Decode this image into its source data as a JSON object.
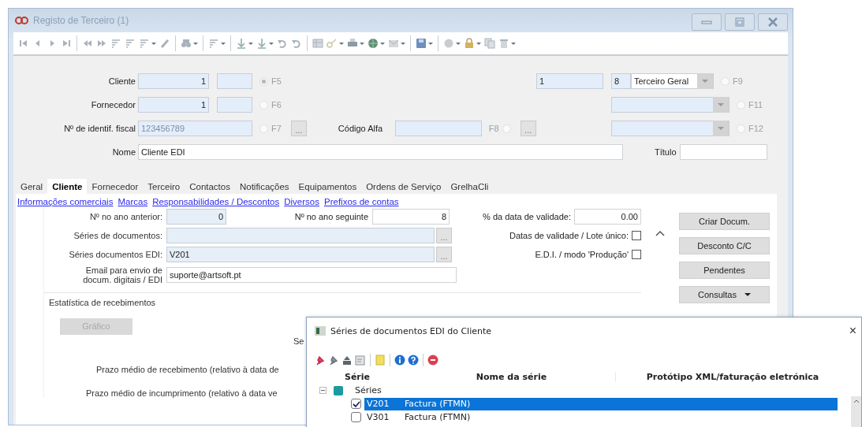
{
  "window": {
    "title": "Registo de Terceiro (1)"
  },
  "header": {
    "rows": [
      {
        "kind": "split",
        "label": "Cliente",
        "value": "1",
        "radio": {
          "label": "F5",
          "selected": true
        }
      },
      {
        "kind": "split",
        "label": "Fornecedor",
        "value": "1",
        "radio": {
          "label": "F6",
          "selected": false
        }
      },
      {
        "kind": "wide",
        "label": "Nº de identif. fiscal",
        "value": "123456789",
        "radio": {
          "label": "F7",
          "selected": false
        },
        "button": "..."
      }
    ],
    "alt_code": {
      "label": "Código Alfa",
      "radio": {
        "label": "F8",
        "selected": false
      },
      "button": "..."
    },
    "right_rows": [
      {
        "kind": "code",
        "value": "1",
        "code": "8",
        "combo": "Terceiro Geral",
        "radio": {
          "label": "F9",
          "selected": false
        }
      },
      {
        "kind": "combo",
        "radio": {
          "label": "F11",
          "selected": false
        }
      },
      {
        "kind": "combo",
        "radio": {
          "label": "F12",
          "selected": false
        }
      }
    ],
    "name": {
      "label": "Nome",
      "value": "Cliente EDI"
    },
    "title_field": {
      "label": "Título"
    }
  },
  "tabs": [
    {
      "label": "Geral",
      "selected": false
    },
    {
      "label": "Cliente",
      "selected": true
    },
    {
      "label": "Fornecedor",
      "selected": false
    },
    {
      "label": "Terceiro",
      "selected": false
    },
    {
      "label": "Contactos",
      "selected": false
    },
    {
      "label": "Notificações",
      "selected": false
    },
    {
      "label": "Equipamentos",
      "selected": false
    },
    {
      "label": "Ordens de Serviço",
      "selected": false
    },
    {
      "label": "GrelhaCli",
      "selected": false
    }
  ],
  "links": [
    "Informações comerciais",
    "Marcas",
    "Responsabilidades / Descontos",
    "Diversos",
    "Prefixos de contas"
  ],
  "counters": [
    {
      "label": "Nº no ano anterior:",
      "value": "0"
    },
    {
      "label": "Nº no ano seguinte",
      "value": "8"
    }
  ],
  "validity": {
    "label": "% da data de validade:",
    "value": "0.00"
  },
  "fields": [
    {
      "label": "Séries de documentos:",
      "button": "..."
    },
    {
      "label": "Séries documentos EDI:",
      "value": "V201",
      "button": "..."
    },
    {
      "label": "Email para envio de docum. digitais / EDI",
      "value": "suporte@artsoft.pt"
    }
  ],
  "checks": [
    {
      "label": "Datas de validade / Lote único:",
      "checked": false
    },
    {
      "label": "E.D.I. / modo 'Produção'",
      "checked": false
    }
  ],
  "actions": [
    {
      "label": "Criar Docum.",
      "kind": "plain"
    },
    {
      "label": "Desconto C/C",
      "kind": "plain"
    },
    {
      "label": "Pendentes",
      "kind": "plain"
    },
    {
      "label": "Consultas",
      "kind": "menu"
    }
  ],
  "statistics": {
    "title": "Estatística de recebimentos",
    "button": {
      "label": "Gráfico",
      "disabled": true
    },
    "texts": [
      "Se",
      "Prazo médio de recebimento (relativo à data de",
      "Prazo médio de incumprimento (relativo à data ve"
    ]
  },
  "dialog": {
    "title": "Séries de documentos EDI do Cliente",
    "close": "×",
    "columns": [
      "Série",
      "Nome da série",
      "Protótipo XML/faturação eletrónica"
    ],
    "tree": [
      {
        "label": "Séries",
        "expanded": true,
        "children": [
          {
            "code": "V201",
            "name": "Factura (FTMN)",
            "checked": true,
            "selected": true
          },
          {
            "code": "V301",
            "name": "Factura (FTMN)",
            "checked": false,
            "selected": false
          }
        ]
      }
    ]
  }
}
